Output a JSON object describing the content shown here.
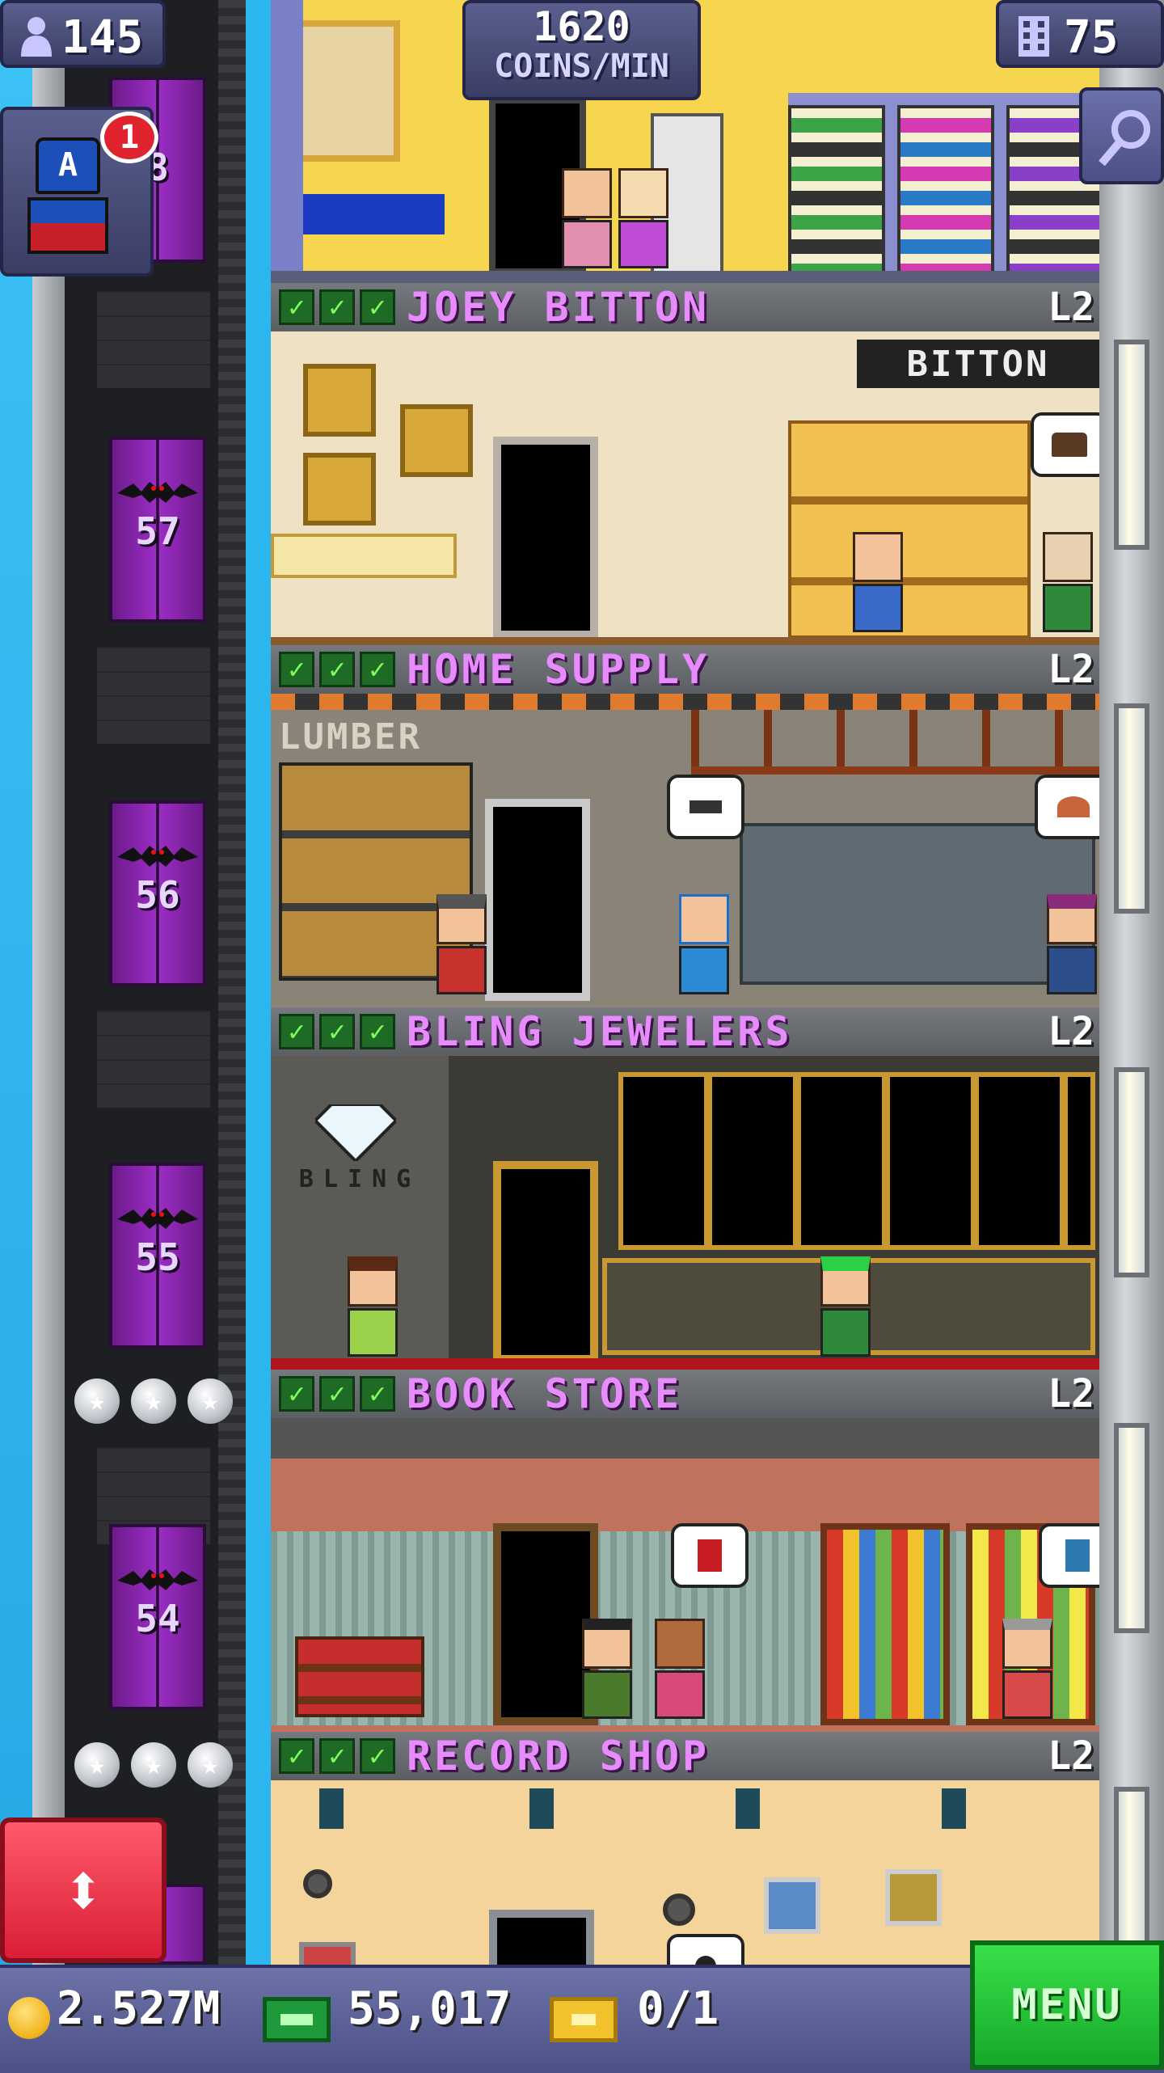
{
  "hud": {
    "population": "145",
    "coins_rate_value": "1620",
    "coins_rate_unit": "COINS/MIN",
    "floors_count": "75",
    "notification_count": "1",
    "colors": {
      "hud_bg": "#4b5086",
      "accent_purple": "#e88bff"
    }
  },
  "elevator": {
    "floor_numbers": [
      "57",
      "56",
      "55",
      "54"
    ],
    "partial_top_number": "8"
  },
  "floors": [
    {
      "name": "JOEY BITTON",
      "level": "L2",
      "checks": 3,
      "sign": "BITTON"
    },
    {
      "name": "HOME SUPPLY",
      "level": "L2",
      "checks": 3,
      "sign": "LUMBER"
    },
    {
      "name": "BLING JEWELERS",
      "level": "L2",
      "checks": 3,
      "sign": "BLING"
    },
    {
      "name": "BOOK STORE",
      "level": "L2",
      "checks": 3
    },
    {
      "name": "RECORD SHOP",
      "level": "L2",
      "checks": 3
    }
  ],
  "bottom": {
    "coins": "2.527M",
    "bux": "55,017",
    "tickets": "0/1",
    "menu_label": "MENU"
  },
  "icons": [
    "person-icon",
    "building-icon",
    "search-icon",
    "coin-icon",
    "bux-icon",
    "ticket-icon",
    "elevator-updown-icon",
    "checkmark-icon",
    "star-icon",
    "bat-icon"
  ]
}
